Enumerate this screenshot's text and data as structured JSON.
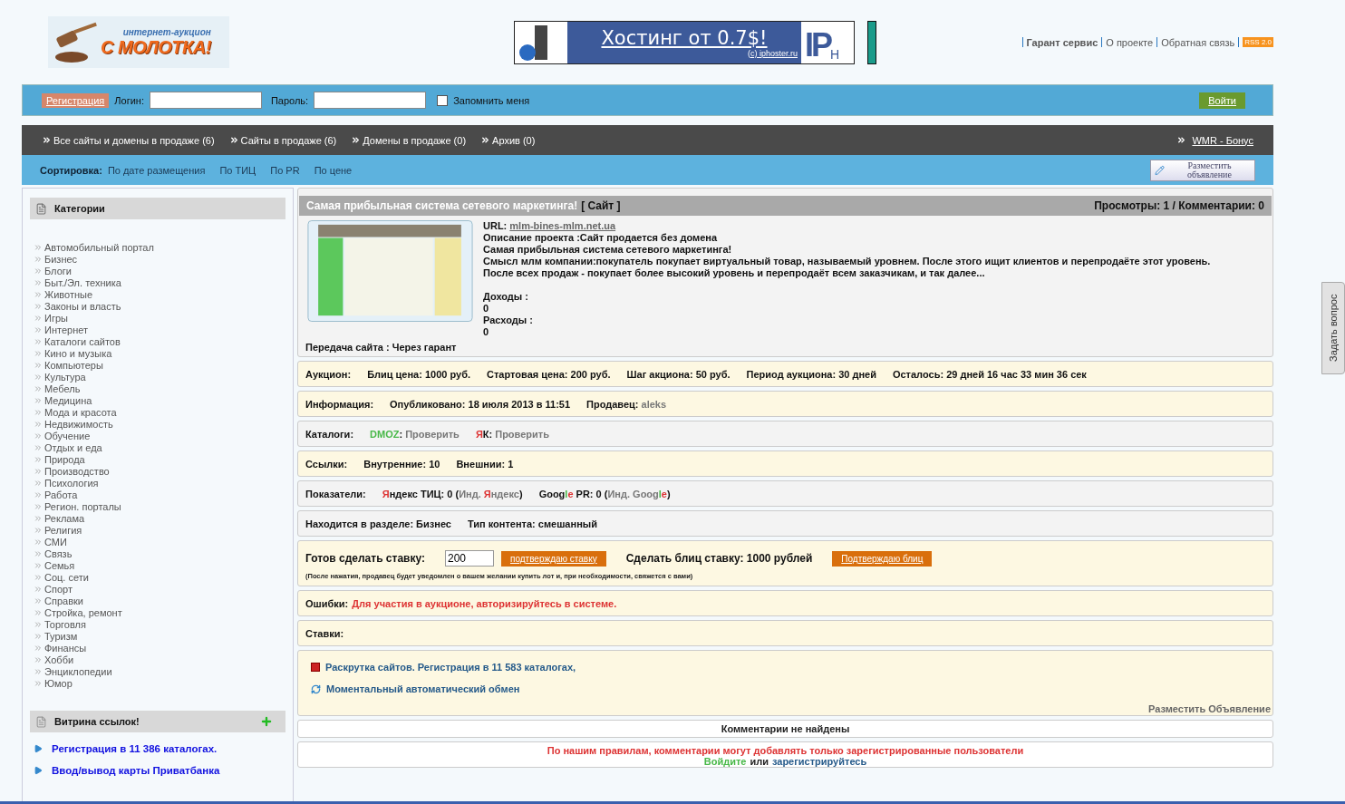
{
  "header": {
    "logo": {
      "tagline": "интернет-аукцион",
      "name": "С МОЛОТКА!"
    },
    "banner": {
      "headline": "Хостинг от 0.7$!",
      "credit": "(c) iphoster.ru",
      "brand": "IP",
      "brand_sub": "H"
    },
    "links": [
      {
        "label": "Гарант сервис",
        "bold": true
      },
      {
        "label": "О проекте",
        "bold": false
      },
      {
        "label": "Обратная связь",
        "bold": false
      }
    ],
    "rss": "RSS 2.0"
  },
  "login": {
    "register": "Регистрация",
    "login_label": "Логин:",
    "password_label": "Пароль:",
    "remember": {
      "label": "Запомнить меня",
      "checked": false
    },
    "submit": "Войти"
  },
  "nav": {
    "items": [
      "Все сайты и домены в продаже (6)",
      "Сайты в продаже (6)",
      "Домены в продаже (0)",
      "Архив (0)"
    ],
    "bonus": "WMR - Бонус"
  },
  "sort": {
    "label": "Сортировка:",
    "options": [
      "По дате размещения",
      "По ТИЦ",
      "По PR",
      "По цене"
    ],
    "post_button": "Разместить объявление"
  },
  "sidebar": {
    "categories": {
      "title": "Категории",
      "items": [
        "Автомобильный портал",
        "Бизнес",
        "Блоги",
        "Быт./Эл. техника",
        "Животные",
        "Законы и власть",
        "Игры",
        "Интернет",
        "Каталоги сайтов",
        "Кино и музыка",
        "Компьютеры",
        "Культура",
        "Мебель",
        "Медицина",
        "Мода и красота",
        "Недвижимость",
        "Обучение",
        "Отдых и еда",
        "Природа",
        "Производство",
        "Психология",
        "Работа",
        "Регион. порталы",
        "Реклама",
        "Религия",
        "СМИ",
        "Связь",
        "Семья",
        "Соц. сети",
        "Спорт",
        "Справки",
        "Стройка, ремонт",
        "Торговля",
        "Туризм",
        "Финансы",
        "Хобби",
        "Энциклопедии",
        "Юмор"
      ]
    },
    "showcase": {
      "title": "Витрина ссылок!",
      "links": [
        "Регистрация в 11 386 каталогах.",
        "Ввод/вывод карты Приватбанка"
      ]
    }
  },
  "listing": {
    "title": "Самая прибыльная система сетевого маркетинга!",
    "type": "[ Сайт ]",
    "stats": "Просмотры: 1 / Комментарии: 0",
    "url_label": "URL:",
    "url": "mlm-bines-mlm.net.ua",
    "description": [
      "Описание проекта :Сайт продается без домена",
      "Самая прибыльная система сетевого маркетинга!",
      "Смысл млм компании:покупатель покупает виртуальный товар, называемый уровнем. После этого ищит клиентов и перепродаёте этот уровень.",
      "После всех продаж - покупает более высокий уровень и перепродаёт всем заказчикам, и так далее..."
    ],
    "income_label": "Доходы :",
    "income": "0",
    "expenses_label": "Расходы :",
    "expenses": "0",
    "transfer": "Передача сайта : Через гарант"
  },
  "rows": [
    {
      "shaded": false,
      "cells": [
        [
          {
            "text": "Аукцион:",
            "kind": "plain"
          }
        ],
        [
          {
            "text": "Блиц цена: 1000 руб.",
            "kind": "plain"
          }
        ],
        [
          {
            "text": "Стартовая цена: 200 руб.",
            "kind": "plain"
          }
        ],
        [
          {
            "text": "Шаг акциона: 50 руб.",
            "kind": "plain"
          }
        ],
        [
          {
            "text": "Период аукциона: 30 дней",
            "kind": "plain"
          }
        ],
        [
          {
            "text": "Осталось: 29 дней 16 час 33 мин 36 сек",
            "kind": "plain"
          }
        ]
      ]
    },
    {
      "shaded": false,
      "cells": [
        [
          {
            "text": "Информация:",
            "kind": "plain"
          }
        ],
        [
          {
            "text": "Опубликовано: 18 июля 2013 в 11:51",
            "kind": "plain"
          }
        ],
        [
          {
            "text": "Продавец: ",
            "kind": "plain"
          },
          {
            "text": "aleks",
            "kind": "muted"
          }
        ]
      ]
    },
    {
      "shaded": true,
      "cells": [
        [
          {
            "text": "Каталоги:",
            "kind": "plain"
          }
        ],
        [
          {
            "text": "DMOZ",
            "kind": "green"
          },
          {
            "text": ": ",
            "kind": "plain"
          },
          {
            "text": "Проверить",
            "kind": "muted"
          }
        ],
        [
          {
            "text": "Я",
            "kind": "red"
          },
          {
            "text": "К: ",
            "kind": "plain"
          },
          {
            "text": "Проверить",
            "kind": "muted"
          }
        ]
      ]
    },
    {
      "shaded": false,
      "cells": [
        [
          {
            "text": "Ссылки:",
            "kind": "plain"
          }
        ],
        [
          {
            "text": "Внутренние: 10",
            "kind": "plain"
          }
        ],
        [
          {
            "text": "Внешнии: 1",
            "kind": "plain"
          }
        ]
      ]
    },
    {
      "shaded": true,
      "cells": [
        [
          {
            "text": "Показатели:",
            "kind": "plain"
          }
        ],
        [
          {
            "text": "Я",
            "kind": "red"
          },
          {
            "text": "ндекс ТИЦ: 0 (",
            "kind": "plain"
          },
          {
            "text": "Инд. ",
            "kind": "muted"
          },
          {
            "text": "Я",
            "kind": "red"
          },
          {
            "text": "ндекс",
            "kind": "muted"
          },
          {
            "text": ")",
            "kind": "plain"
          }
        ],
        [
          {
            "text": "Goog",
            "kind": "plain"
          },
          {
            "text": "l",
            "kind": "green"
          },
          {
            "text": "e",
            "kind": "red"
          },
          {
            "text": " PR: 0 (",
            "kind": "plain"
          },
          {
            "text": "Инд. Goog",
            "kind": "muted"
          },
          {
            "text": "l",
            "kind": "green"
          },
          {
            "text": "e",
            "kind": "red"
          },
          {
            "text": ")",
            "kind": "plain"
          }
        ]
      ]
    },
    {
      "shaded": true,
      "cells": [
        [
          {
            "text": "Находится в разделе: Бизнес",
            "kind": "plain"
          }
        ],
        [
          {
            "text": "Тип контента: смешанный",
            "kind": "plain"
          }
        ]
      ]
    }
  ],
  "bid": {
    "label": "Готов сделать ставку:",
    "value": "200",
    "confirm": "подтверждаю ставку",
    "blitz_label": "Сделать блиц ставку: 1000 рублей",
    "blitz_confirm": "Подтверждаю блиц",
    "note": "(После нажатия, продавец будет уведомлен о вашем желании купить лот и, при необходимости, свяжется с вами)"
  },
  "errors": {
    "label": "Ошибки:",
    "message": "Для участия в аукционе, авторизируйтесь в системе."
  },
  "bids": {
    "label": "Ставки:"
  },
  "ads": {
    "links": [
      {
        "kind": "ips",
        "label": "Раскрутка сайтов. Регистрация в 11 583 каталогах,"
      },
      {
        "kind": "exchange",
        "label": "Моментальный автоматический обмен"
      }
    ],
    "post": "Разместить Объявление"
  },
  "comments": {
    "empty": "Комментарии не найдены",
    "rule": "По нашим правилам, комментарии могут добавлять только зарегистрированные пользователи",
    "login": "Войдите",
    "or": "или",
    "register": "зарегистрируйтесь"
  },
  "side_tab": "Задать вопрос"
}
